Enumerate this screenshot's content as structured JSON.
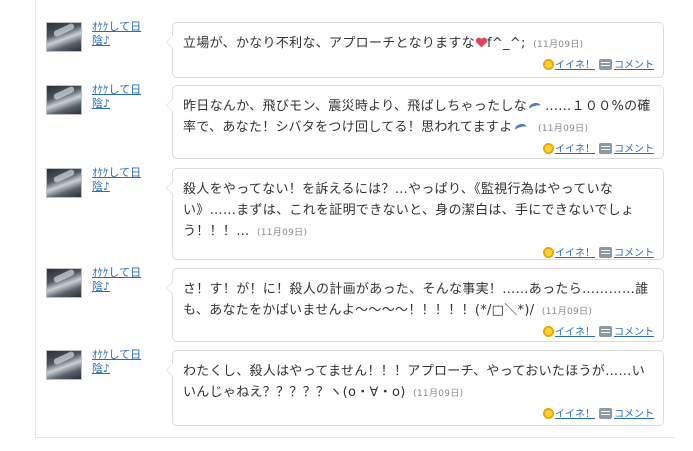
{
  "entries": [
    {
      "user": "ｵｹｹして日陰♪",
      "parts": [
        "立場が、かなり不利な、アプローチとなりますな",
        "f^_^;"
      ],
      "emoji": "heart",
      "date": "(11月09日)",
      "like": "イイネ！",
      "comment": "コメント"
    },
    {
      "user": "ｵｹｹして日陰♪",
      "parts": [
        "昨日なんか、飛びモン、震災時より、飛ばしちゃったしな",
        "……１００%の確率で、あなた！シバタをつけ回してる！思われてますよ"
      ],
      "emoji": "wave",
      "date": "(11月09日)",
      "like": "イイネ！",
      "comment": "コメント"
    },
    {
      "user": "ｵｹｹして日陰♪",
      "parts": [
        "殺人をやってない！を訴えるには？…やっぱり、《監視行為はやっていない》……まずは、これを証明できないと、身の潔白は、手にできないでしょう！！！…"
      ],
      "emoji": "",
      "date": "(11月09日)",
      "like": "イイネ！",
      "comment": "コメント"
    },
    {
      "user": "ｵｹｹして日陰♪",
      "parts": [
        "さ！す！が！に！殺人の計画があった、そんな事実！……あったら…………誰も、あなたをかばいませんよ〜〜〜〜！！！！！(*/□＼*)/"
      ],
      "emoji": "",
      "date": "(11月09日)",
      "like": "イイネ！",
      "comment": "コメント"
    },
    {
      "user": "ｵｹｹして日陰♪",
      "parts": [
        "わたくし、殺人はやってません！！！アプローチ、やっておいたほうが……いいんじゃねえ？？？？？ヽ(o・∀・o)"
      ],
      "emoji": "",
      "date": "(11月09日)",
      "like": "イイネ！",
      "comment": "コメント"
    }
  ],
  "icons": {
    "like": "star-icon",
    "comment": "comment-icon",
    "emoji_heart": "heart-emoji-icon",
    "emoji_wave": "wave-emoji-icon"
  },
  "colors": {
    "link": "#2a6fb5",
    "border": "#dcdcdc",
    "date": "#888888"
  }
}
